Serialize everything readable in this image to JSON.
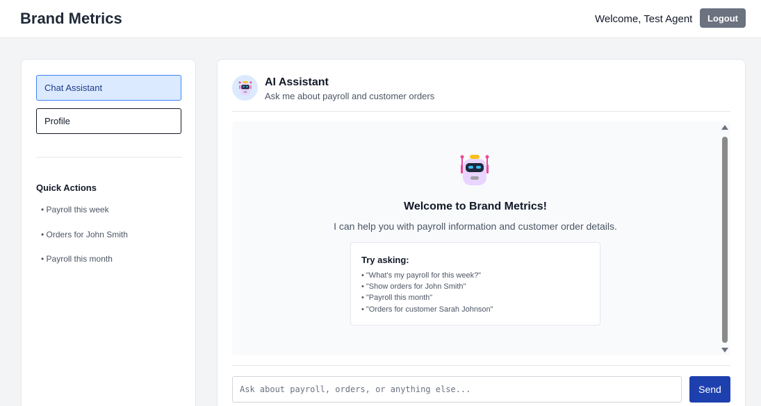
{
  "header": {
    "brand": "Brand Metrics",
    "welcome": "Welcome, Test Agent",
    "logout_label": "Logout"
  },
  "sidebar": {
    "nav": [
      {
        "label": "Chat Assistant",
        "active": true
      },
      {
        "label": "Profile",
        "active": false
      }
    ],
    "quick_actions_title": "Quick Actions",
    "quick_actions": [
      "• Payroll this week",
      "• Orders for John Smith",
      "• Payroll this month"
    ]
  },
  "assistant": {
    "title": "AI Assistant",
    "subtitle": "Ask me about payroll and customer orders",
    "icon": "robot-icon"
  },
  "chat": {
    "welcome_title": "Welcome to Brand Metrics!",
    "welcome_sub": "I can help you with payroll information and customer order details.",
    "try_title": "Try asking:",
    "suggestions": [
      "• \"What's my payroll for this week?\"",
      "• \"Show orders for John Smith\"",
      "• \"Payroll this month\"",
      "• \"Orders for customer Sarah Johnson\""
    ]
  },
  "input": {
    "placeholder": "Ask about payroll, orders, or anything else...",
    "value": "",
    "send_label": "Send"
  },
  "colors": {
    "accent": "#1e40af",
    "active_nav_bg": "#dbeafe",
    "logout_bg": "#6b7280"
  }
}
